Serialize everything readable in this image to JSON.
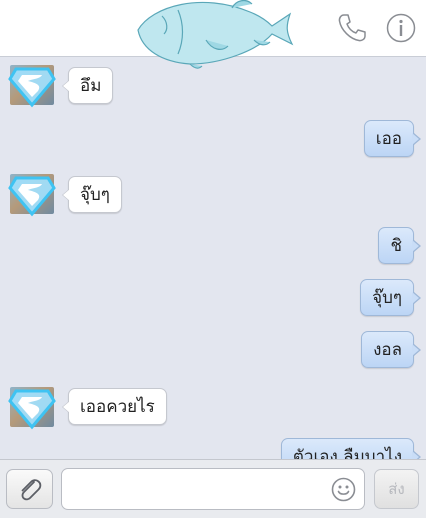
{
  "header": {
    "phone_icon": "phone-icon",
    "info_icon": "info-icon",
    "mascot": "fish-illustration"
  },
  "messages": [
    {
      "side": "in",
      "text": "อึม"
    },
    {
      "side": "out",
      "text": "เออ"
    },
    {
      "side": "in",
      "text": "จุ๊บๆ"
    },
    {
      "side": "out",
      "text": "ชิ"
    },
    {
      "side": "out",
      "text": "จุ๊บๆ"
    },
    {
      "side": "out",
      "text": "งอล"
    },
    {
      "side": "in",
      "text": "เออควยไร"
    },
    {
      "side": "out",
      "text": "ตัวเอง ลืมบาไง"
    }
  ],
  "composer": {
    "attach_icon": "paperclip-icon",
    "input_value": "",
    "emoji_icon": "smiley-icon",
    "send_label": "ส่ง"
  },
  "colors": {
    "chat_background": "#e3e6ef",
    "outgoing_bubble": "#c9ddf7",
    "incoming_bubble": "#ffffff",
    "avatar_glow": "#3fc3f2"
  }
}
